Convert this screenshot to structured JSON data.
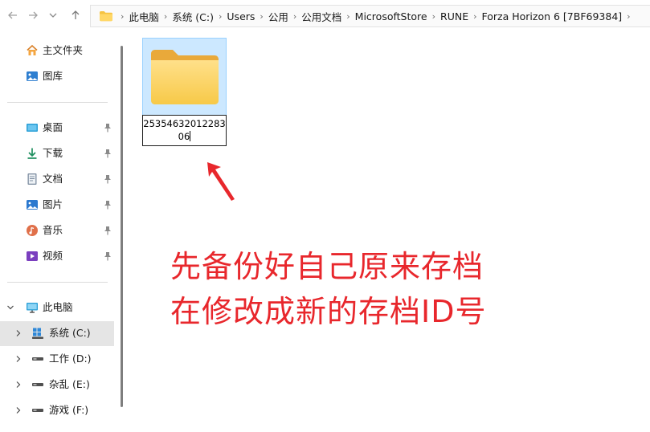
{
  "toolbar": {
    "back_icon": "back-arrow-icon",
    "forward_icon": "forward-arrow-icon",
    "history_icon": "chevron-down-icon",
    "up_icon": "up-arrow-icon"
  },
  "address_bar": {
    "crumbs": [
      "此电脑",
      "系统 (C:)",
      "Users",
      "公用",
      "公用文档",
      "MicrosoftStore",
      "RUNE",
      "Forza Horizon 6 [7BF69384]"
    ]
  },
  "sidebar": {
    "quick": [
      {
        "label": "主文件夹",
        "icon": "home-icon"
      },
      {
        "label": "图库",
        "icon": "gallery-icon"
      }
    ],
    "pinned": [
      {
        "label": "桌面",
        "icon": "desktop-icon"
      },
      {
        "label": "下载",
        "icon": "download-icon"
      },
      {
        "label": "文档",
        "icon": "document-icon"
      },
      {
        "label": "图片",
        "icon": "picture-icon"
      },
      {
        "label": "音乐",
        "icon": "music-icon"
      },
      {
        "label": "视频",
        "icon": "video-icon"
      }
    ],
    "this_pc": {
      "label": "此电脑",
      "icon": "computer-icon"
    },
    "drives": [
      {
        "label": "系统 (C:)",
        "icon": "windows-drive-icon",
        "selected": true
      },
      {
        "label": "工作 (D:)",
        "icon": "drive-icon"
      },
      {
        "label": "杂乱 (E:)",
        "icon": "drive-icon"
      },
      {
        "label": "游戏 (F:)",
        "icon": "drive-icon"
      }
    ]
  },
  "content": {
    "folder_name_line1": "25354632012283",
    "folder_name_line2": "06",
    "annotation_line1": "先备份好自己原来存档",
    "annotation_line2": "在修改成新的存档ID号"
  },
  "colors": {
    "annotation": "#e8272c",
    "selection": "#cce8ff",
    "folder": "#f7c948"
  }
}
